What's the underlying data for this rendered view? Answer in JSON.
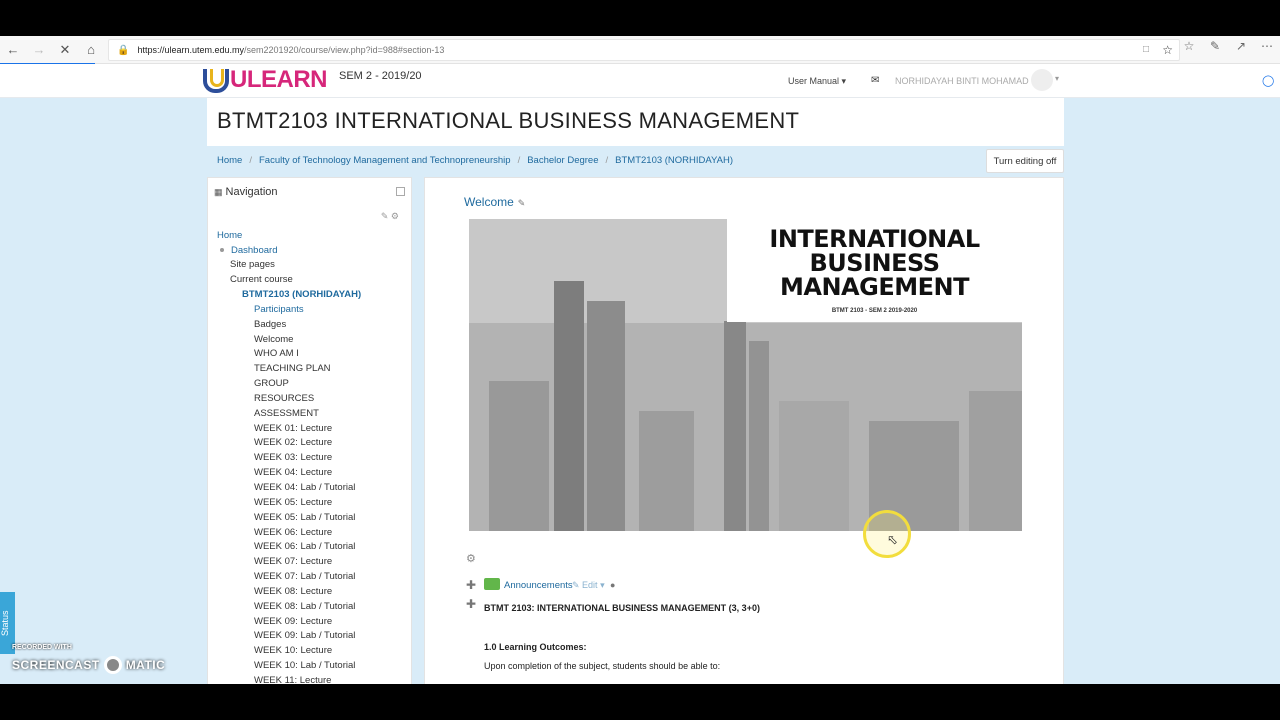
{
  "browser": {
    "url_host": "https://ulearn.utem.edu.my",
    "url_path": "/sem2201920/course/view.php?id=988#section-13"
  },
  "header": {
    "logo_text": "ULEARN",
    "semester": "SEM 2 - 2019/20",
    "user_manual": "User Manual",
    "username": "NORHIDAYAH BINTI MOHAMAD"
  },
  "page": {
    "title": "BTMT2103 INTERNATIONAL BUSINESS MANAGEMENT",
    "turn_editing": "Turn editing off"
  },
  "breadcrumbs": [
    "Home",
    "Faculty of Technology Management and Technopreneurship",
    "Bachelor Degree",
    "BTMT2103 (NORHIDAYAH)"
  ],
  "navigation": {
    "title": "Navigation",
    "items": [
      {
        "label": "Home"
      },
      {
        "label": "Dashboard"
      },
      {
        "label": "Site pages"
      },
      {
        "label": "Current course"
      },
      {
        "label": "BTMT2103 (NORHIDAYAH)"
      },
      {
        "label": "Participants"
      },
      {
        "label": "Badges"
      },
      {
        "label": "Welcome"
      },
      {
        "label": "WHO AM I"
      },
      {
        "label": "TEACHING PLAN"
      },
      {
        "label": "GROUP"
      },
      {
        "label": "RESOURCES"
      },
      {
        "label": "ASSESSMENT"
      },
      {
        "label": "WEEK 01: Lecture"
      },
      {
        "label": "WEEK 02: Lecture"
      },
      {
        "label": "WEEK 03: Lecture"
      },
      {
        "label": "WEEK 04: Lecture"
      },
      {
        "label": "WEEK 04: Lab / Tutorial"
      },
      {
        "label": "WEEK 05: Lecture"
      },
      {
        "label": "WEEK 05: Lab / Tutorial"
      },
      {
        "label": "WEEK 06: Lecture"
      },
      {
        "label": "WEEK 06: Lab / Tutorial"
      },
      {
        "label": "WEEK 07: Lecture"
      },
      {
        "label": "WEEK 07: Lab / Tutorial"
      },
      {
        "label": "WEEK 08: Lecture"
      },
      {
        "label": "WEEK 08: Lab / Tutorial"
      },
      {
        "label": "WEEK 09: Lecture"
      },
      {
        "label": "WEEK 09: Lab / Tutorial"
      },
      {
        "label": "WEEK 10: Lecture"
      },
      {
        "label": "WEEK 10: Lab / Tutorial"
      },
      {
        "label": "WEEK 11: Lecture"
      }
    ]
  },
  "main": {
    "section_title": "Welcome",
    "banner_title": "INTERNATIONAL BUSINESS MANAGEMENT",
    "banner_subtitle": "BTMT 2103 - SEM 2 2019-2020",
    "announcements": "Announcements",
    "edit": "Edit",
    "course_heading": "BTMT 2103: INTERNATIONAL BUSINESS MANAGEMENT (3, 3+0)",
    "lo_heading": "1.0  Learning Outcomes:",
    "lo_intro": "Upon completion of the subject, students should be able to:"
  },
  "overlay": {
    "status": "Status",
    "recorded_with": "RECORDED WITH",
    "screencast": "SCREENCAST",
    "matic": "MATIC"
  }
}
